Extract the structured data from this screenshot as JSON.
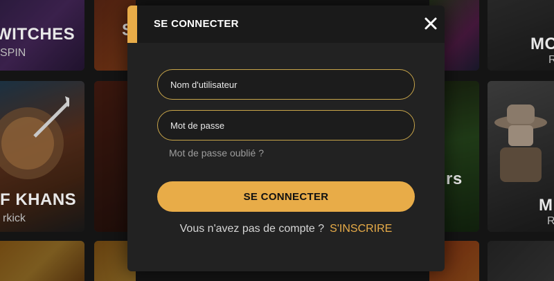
{
  "background": {
    "tiles": [
      {
        "title": "WITCHES",
        "sub": "SPIN"
      },
      {
        "title": "F KHANS",
        "sub": "rkick"
      },
      {
        "title": "MO",
        "sub": "R"
      },
      {
        "title": "M",
        "sub": "R"
      },
      {
        "title": "rs",
        "sub": ""
      },
      {
        "title": "S",
        "sub": ""
      }
    ]
  },
  "modal": {
    "title": "SE CONNECTER",
    "username_placeholder": "Nom d'utilisateur",
    "password_placeholder": "Mot de passe",
    "forgot_label": "Mot de passe oublié ?",
    "submit_label": "SE CONNECTER",
    "register_question": "Vous n'avez pas de compte ?",
    "register_link": "S'INSCRIRE"
  },
  "colors": {
    "accent": "#e8ac48",
    "modal_bg": "#222222",
    "header_bg": "#1a1a1a",
    "field_border": "#c9a64a"
  },
  "icons": {
    "close": "close-icon"
  }
}
